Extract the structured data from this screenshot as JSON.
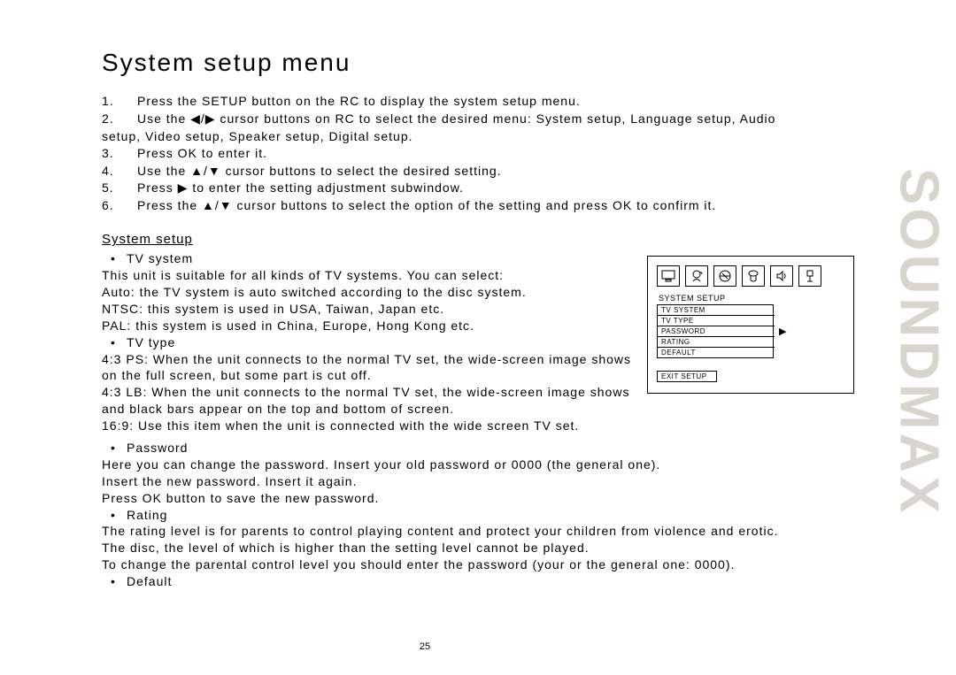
{
  "title": "System setup menu",
  "steps": [
    "Press the SETUP button on the RC to display the system setup menu.",
    "Use the ◀/▶ cursor buttons on RC to select the desired menu: System setup, Language setup, Audio setup, Video setup, Speaker setup, Digital setup.",
    "Press OK to enter it.",
    "Use the ▲/▼ cursor buttons to select the desired setting.",
    "Press ▶ to enter the setting adjustment subwindow.",
    "Press the ▲/▼ cursor buttons to select the option of the setting and press OK to confirm it."
  ],
  "section_heading": "System setup",
  "tv_system": {
    "label": "TV system",
    "intro": "This unit is suitable for all kinds of TV systems. You can select:",
    "lines": [
      "Auto: the TV system is auto switched according to the disc system.",
      "NTSC: this system is used in USA, Taiwan, Japan etc.",
      "PAL: this system is used in China, Europe, Hong Kong etc."
    ]
  },
  "tv_type": {
    "label": "TV type",
    "lines": [
      "4:3 PS: When the unit connects to the normal TV set, the wide-screen image shows on the full screen, but some part is cut off.",
      "4:3 LB: When the unit connects to the normal TV set, the wide-screen image shows and black bars appear on the top and bottom of screen.",
      "16:9: Use this item when the unit is connected with the wide screen TV set."
    ]
  },
  "password": {
    "label": "Password",
    "lines": [
      "Here you can change the password. Insert your old password or 0000 (the general one).",
      "Insert the new password. Insert it again.",
      "Press OK button to save the new password."
    ]
  },
  "rating": {
    "label": "Rating",
    "lines": [
      "The rating level is for parents to control playing content and protect your children from violence and erotic.",
      "The disc, the level of which is higher than the setting level cannot be played.",
      "To change the parental control level you should enter the password (your or the general one: 0000)."
    ]
  },
  "default_label": "Default",
  "osd": {
    "title": "SYSTEM SETUP",
    "rows": [
      "TV SYSTEM",
      "TV TYPE",
      "PASSWORD",
      "RATING",
      "DEFAULT"
    ],
    "selected_index": 0,
    "exit": "EXIT SETUP"
  },
  "page_number": "25",
  "brand": "SOUNDMAX"
}
